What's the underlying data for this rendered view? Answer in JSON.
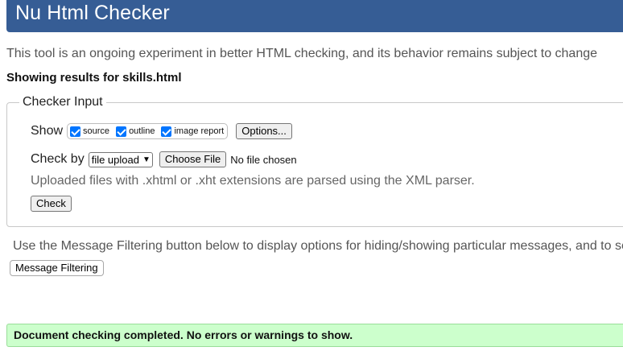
{
  "header": {
    "title": "Nu Html Checker"
  },
  "intro": "This tool is an ongoing experiment in better HTML checking, and its behavior remains subject to change",
  "results_heading": "Showing results for skills.html",
  "checker_input": {
    "legend": "Checker Input",
    "show_label": "Show",
    "show_options": [
      {
        "label": "source",
        "checked": true
      },
      {
        "label": "outline",
        "checked": true
      },
      {
        "label": "image report",
        "checked": true
      }
    ],
    "options_button": "Options...",
    "check_by_label": "Check by",
    "check_by_selected": "file upload",
    "choose_file_button": "Choose File",
    "no_file_text": "No file chosen",
    "hint": "Uploaded files with .xhtml or .xht extensions are parsed using the XML parser.",
    "check_button": "Check"
  },
  "filtering": {
    "text": "Use the Message Filtering button below to display options for hiding/showing particular messages, and to se",
    "button": "Message Filtering"
  },
  "status": {
    "message": "Document checking completed. No errors or warnings to show."
  },
  "colors": {
    "header_bg": "#365d95",
    "success_bg": "#ccffcc",
    "checkbox": "#0075ff"
  }
}
